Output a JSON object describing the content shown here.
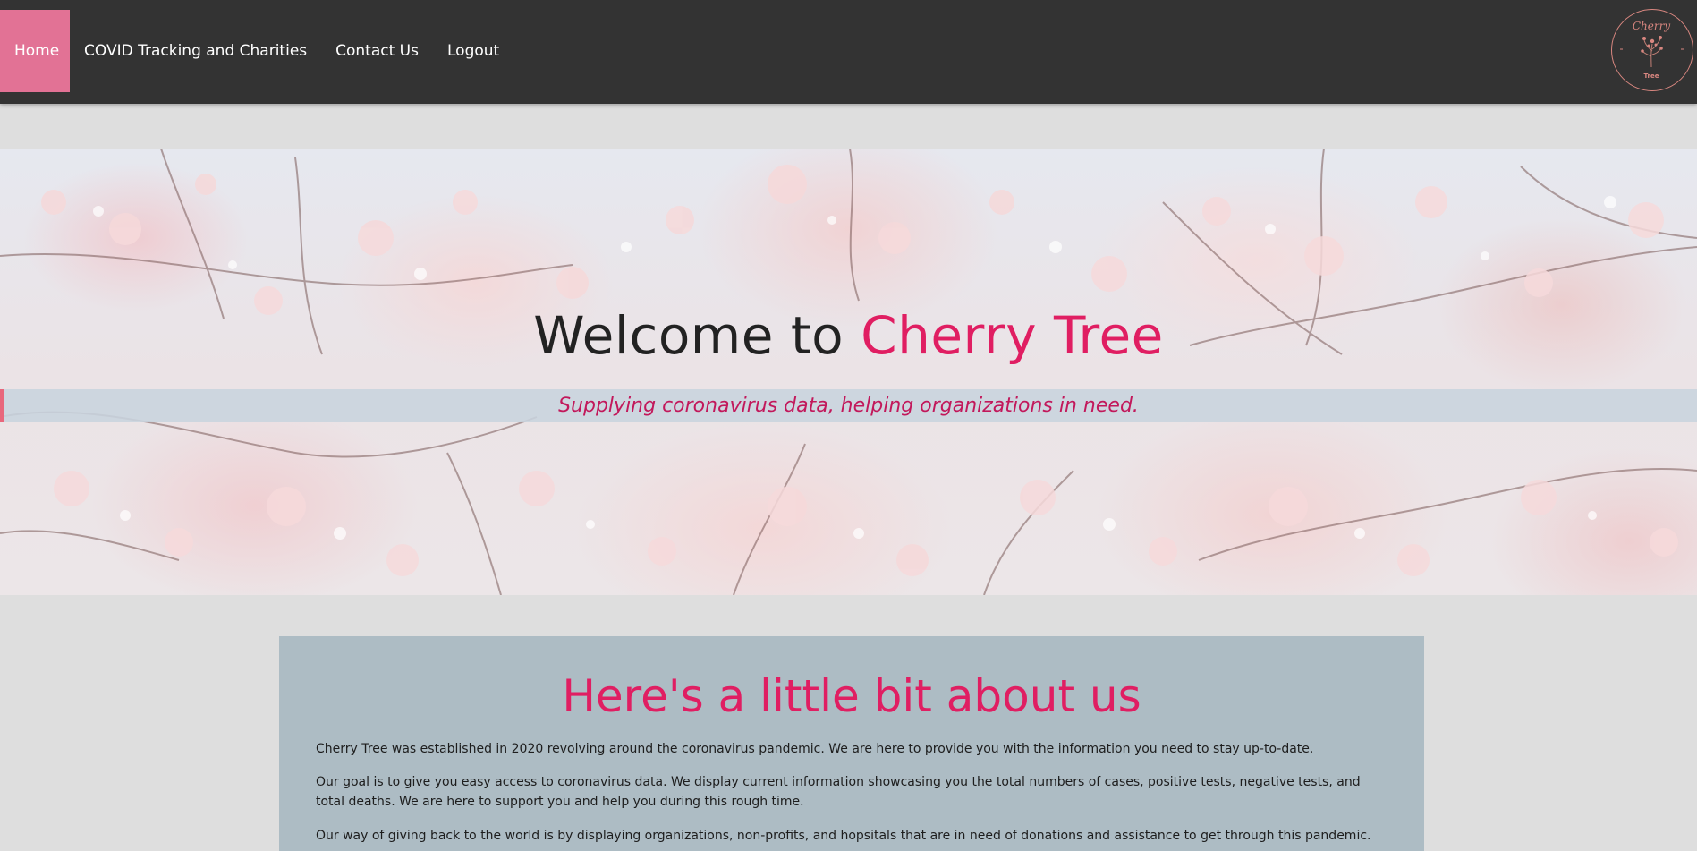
{
  "nav": {
    "items": [
      {
        "label": "Home",
        "active": true
      },
      {
        "label": "COVID Tracking and Charities",
        "active": false
      },
      {
        "label": "Contact Us",
        "active": false
      },
      {
        "label": "Logout",
        "active": false
      }
    ],
    "active_color": "#e27295",
    "background": "#333333"
  },
  "logo": {
    "icon": "cherry-tree-logo",
    "line1": "Cherry",
    "line2": "Tree",
    "color": "#d98780"
  },
  "hero": {
    "title_prefix": "Welcome to ",
    "title_accent": "Cherry Tree",
    "tagline": "Supplying coronavirus data, helping organizations in need.",
    "accent_color": "#e01e62",
    "background": "cherry-blossom-photo"
  },
  "about": {
    "heading": "Here's a little bit about us",
    "paragraphs": [
      "Cherry Tree was established in 2020 revolving around the coronavirus pandemic. We are here to provide you with the information you need to stay up-to-date.",
      "Our goal is to give you easy access to coronavirus data. We display current information showcasing you the total numbers of cases, positive tests, negative tests, and total deaths. We are here to support you and help you during this rough time.",
      "Our way of giving back to the world is by displaying organizations, non-profits, and hopsitals that are in need of donations and assistance to get through this pandemic."
    ],
    "background": "#adbcc4"
  }
}
